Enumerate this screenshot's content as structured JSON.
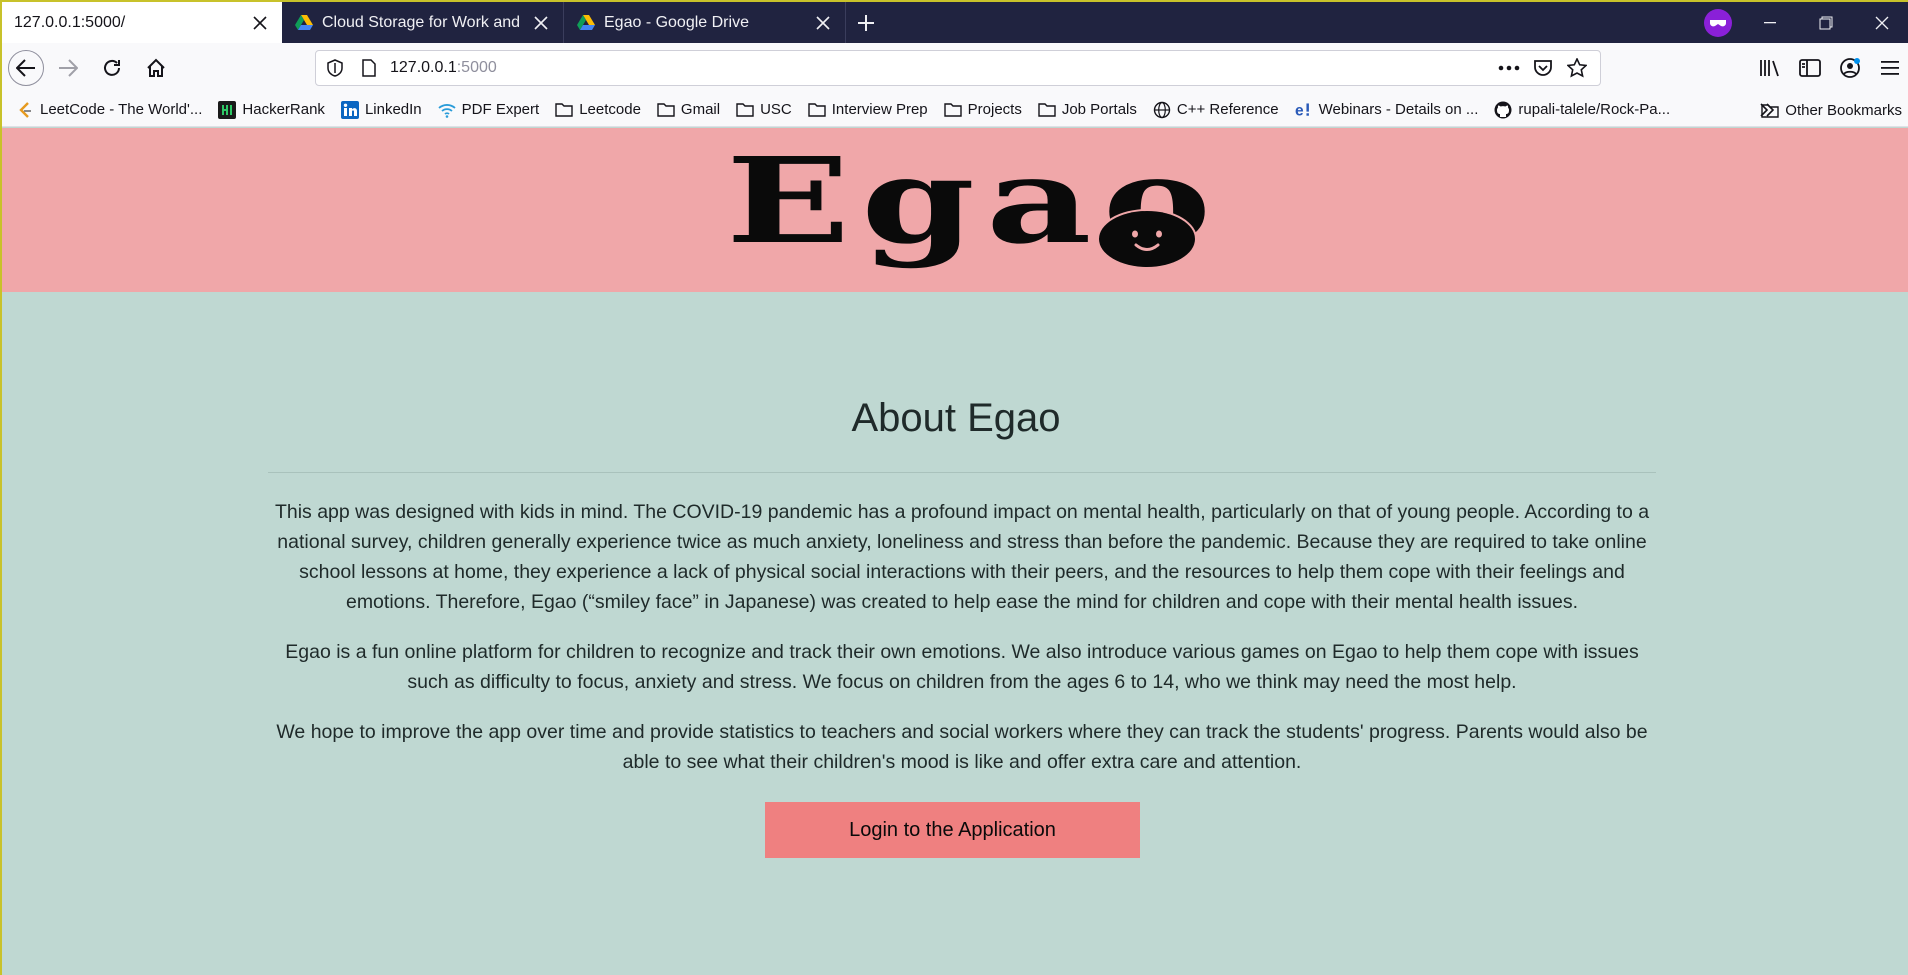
{
  "browser": {
    "tabs": [
      {
        "title": "127.0.0.1:5000/",
        "active": true,
        "icon": "none"
      },
      {
        "title": "Cloud Storage for Work and Home",
        "active": false,
        "icon": "google-drive-icon"
      },
      {
        "title": "Egao - Google Drive",
        "active": false,
        "icon": "google-drive-icon"
      }
    ],
    "url_host": "127.0.0.1",
    "url_port": ":5000",
    "bookmarks": [
      {
        "label": "LeetCode - The World'...",
        "icon": "leetcode-icon"
      },
      {
        "label": "HackerRank",
        "icon": "hackerrank-icon"
      },
      {
        "label": "LinkedIn",
        "icon": "linkedin-icon"
      },
      {
        "label": "PDF Expert",
        "icon": "wifi-icon"
      },
      {
        "label": "Leetcode",
        "icon": "folder-icon"
      },
      {
        "label": "Gmail",
        "icon": "folder-icon"
      },
      {
        "label": "USC",
        "icon": "folder-icon"
      },
      {
        "label": "Interview Prep",
        "icon": "folder-icon"
      },
      {
        "label": "Projects",
        "icon": "folder-icon"
      },
      {
        "label": "Job Portals",
        "icon": "folder-icon"
      },
      {
        "label": "C++ Reference",
        "icon": "globe-icon"
      },
      {
        "label": "Webinars - Details on ...",
        "icon": "webinar-icon"
      },
      {
        "label": "rupali-talele/Rock-Pa...",
        "icon": "github-icon"
      }
    ],
    "other_bookmarks": "Other Bookmarks"
  },
  "page": {
    "logo": "Egao",
    "heading": "About Egao",
    "paragraphs": [
      "This app was designed with kids in mind. The COVID-19 pandemic has a profound impact on mental health, particularly on that of young people. According to a national survey, children generally experience twice as much anxiety, loneliness and stress than before the pandemic. Because they are required to take online school lessons at home, they experience a lack of physical social interactions with their peers, and the resources to help them cope with their feelings and emotions. Therefore, Egao (“smiley face” in Japanese) was created to help ease the mind for children and cope with their mental health issues.",
      "Egao is a fun online platform for children to recognize and track their own emotions. We also introduce various games on Egao to help them cope with issues such as difficulty to focus, anxiety and stress. We focus on children from the ages 6 to 14, who we think may need the most help.",
      "We hope to improve the app over time and provide statistics to teachers and social workers where they can track the students' progress. Parents would also be able to see what their children's mood is like and offer extra care and attention."
    ],
    "login_button": "Login to the Application"
  },
  "colors": {
    "header_bg": "#f0a7a9",
    "content_bg": "#bfd8d2",
    "button_bg": "#ef8080",
    "tabbar_bg": "#202340"
  }
}
